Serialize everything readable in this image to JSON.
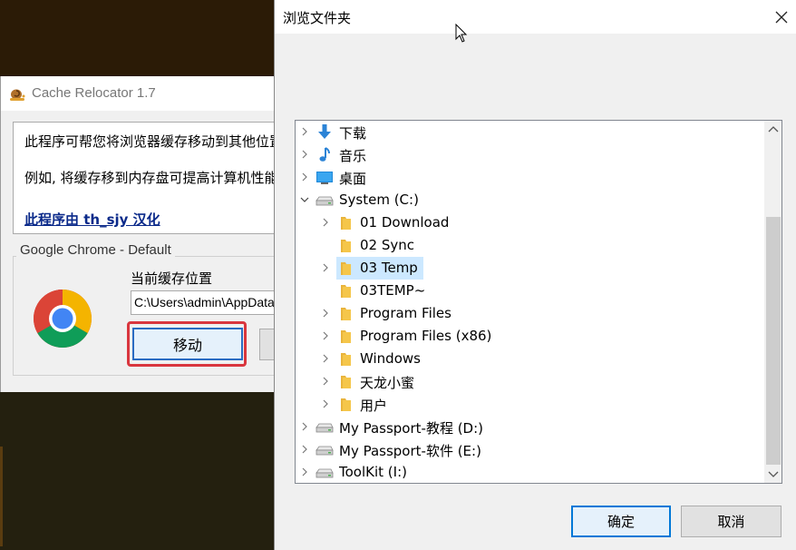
{
  "cache_relocator": {
    "title": "Cache Relocator 1.7",
    "info_line1": "此程序可帮您将浏览器缓存移动到其他位置",
    "info_line2": "例如, 将缓存移到内存盘可提高计算机性能",
    "credit_link": "此程序由 th_sjy 汉化",
    "group_label": "Google Chrome - Default",
    "current_location_label": "当前缓存位置",
    "current_path": "C:\\Users\\admin\\AppData",
    "move_button": "移动"
  },
  "browse_dialog": {
    "title": "浏览文件夹",
    "ok_button": "确定",
    "cancel_button": "取消",
    "tree": [
      {
        "label": "下载",
        "icon": "download-arrow-icon",
        "level": 0,
        "expander": "collapsed"
      },
      {
        "label": "音乐",
        "icon": "music-note-icon",
        "level": 0,
        "expander": "collapsed"
      },
      {
        "label": "桌面",
        "icon": "desktop-icon",
        "level": 0,
        "expander": "collapsed"
      },
      {
        "label": "System (C:)",
        "icon": "drive-icon",
        "level": 0,
        "expander": "expanded"
      },
      {
        "label": "01 Download",
        "icon": "folder-icon",
        "level": 1,
        "expander": "collapsed"
      },
      {
        "label": "02 Sync",
        "icon": "folder-icon",
        "level": 1,
        "expander": "none"
      },
      {
        "label": "03 Temp",
        "icon": "folder-icon",
        "level": 1,
        "expander": "collapsed",
        "selected": true
      },
      {
        "label": "03TEMP~",
        "icon": "folder-icon",
        "level": 1,
        "expander": "none"
      },
      {
        "label": "Program Files",
        "icon": "folder-icon",
        "level": 1,
        "expander": "collapsed"
      },
      {
        "label": "Program Files (x86)",
        "icon": "folder-icon",
        "level": 1,
        "expander": "collapsed"
      },
      {
        "label": "Windows",
        "icon": "folder-icon",
        "level": 1,
        "expander": "collapsed"
      },
      {
        "label": "天龙小蜜",
        "icon": "folder-icon",
        "level": 1,
        "expander": "collapsed"
      },
      {
        "label": "用户",
        "icon": "folder-icon",
        "level": 1,
        "expander": "collapsed"
      },
      {
        "label": "My Passport-教程 (D:)",
        "icon": "drive-icon",
        "level": 0,
        "expander": "collapsed"
      },
      {
        "label": "My Passport-软件 (E:)",
        "icon": "drive-icon",
        "level": 0,
        "expander": "collapsed"
      },
      {
        "label": "ToolKit (I:)",
        "icon": "drive-icon",
        "level": 0,
        "expander": "collapsed"
      }
    ]
  },
  "colors": {
    "selection": "#cce8ff",
    "highlight_border": "#d9363e",
    "button_focus": "#0078d7",
    "folder": "#f5c64a",
    "link": "#0b2a8a"
  }
}
